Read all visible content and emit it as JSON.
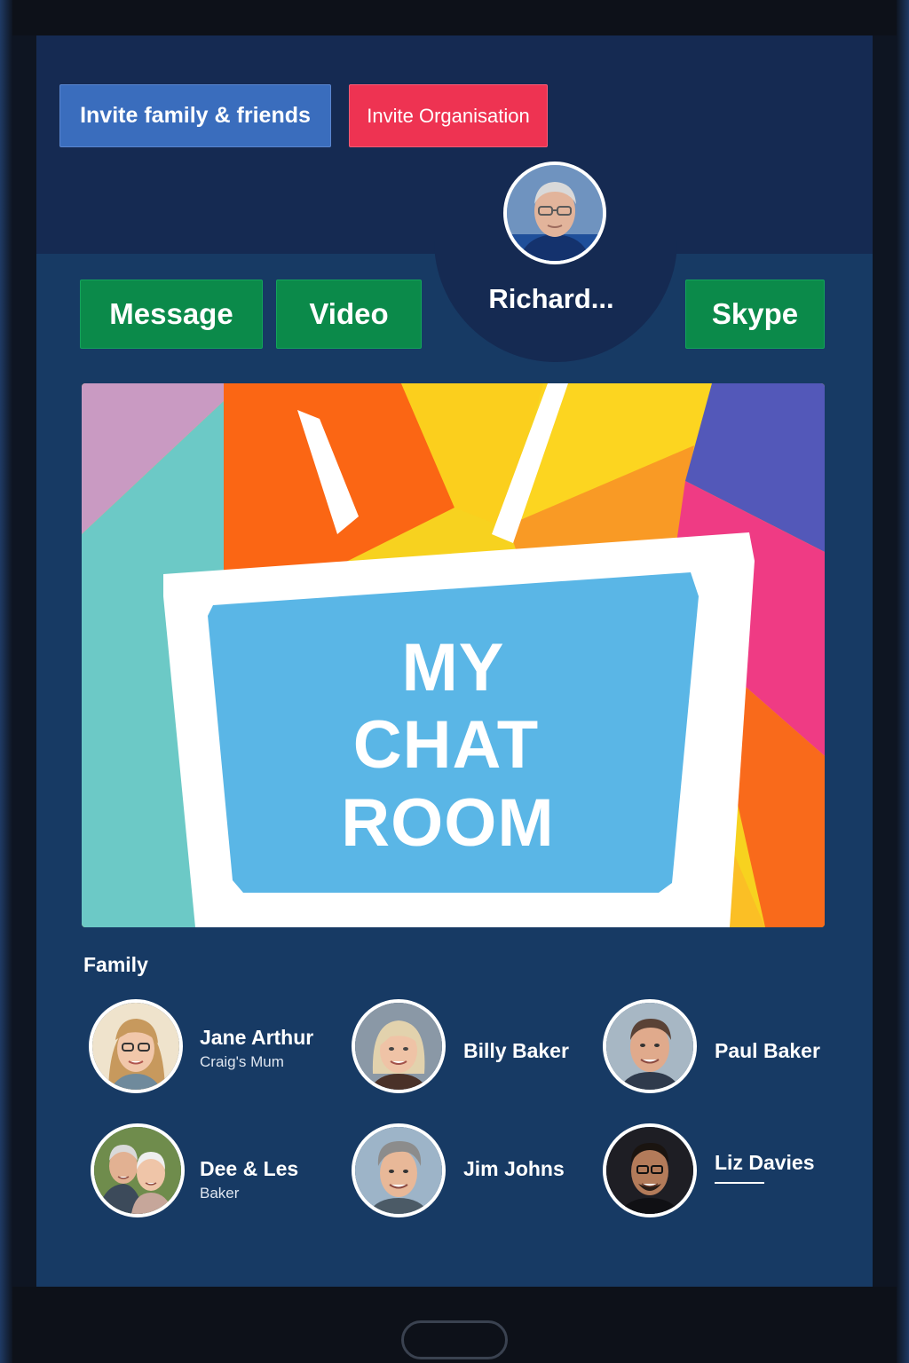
{
  "header": {
    "invite_family_label": "Invite family & friends",
    "invite_org_label": "Invite Organisation"
  },
  "profile": {
    "name": "Richard..."
  },
  "actions": {
    "message_label": "Message",
    "video_label": "Video",
    "skype_label": "Skype"
  },
  "hero": {
    "line1": "MY",
    "line2": "CHAT",
    "line3": "ROOM"
  },
  "family": {
    "section_label": "Family",
    "contacts": [
      {
        "name": "Jane Arthur",
        "subtitle": "Craig's Mum"
      },
      {
        "name": "Billy Baker",
        "subtitle": ""
      },
      {
        "name": "Paul Baker",
        "subtitle": ""
      },
      {
        "name": "Dee & Les",
        "subtitle": "Baker"
      },
      {
        "name": "Jim Johns",
        "subtitle": ""
      },
      {
        "name": "Liz Davies",
        "subtitle": ""
      }
    ]
  },
  "colors": {
    "accent_blue": "#3a6dbd",
    "accent_red": "#ee3352",
    "action_green": "#0b8a4a",
    "background": "#173a64"
  }
}
